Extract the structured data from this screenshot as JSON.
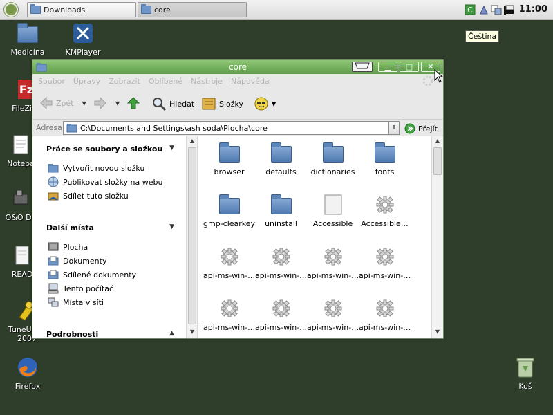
{
  "panel": {
    "tasks": [
      {
        "label": "Downloads"
      },
      {
        "label": "core"
      }
    ],
    "clock": "11:00",
    "language_tooltip": "Čeština"
  },
  "desktop": {
    "icons": [
      {
        "label": "Medicína"
      },
      {
        "label": "KMPlayer"
      },
      {
        "label": "FileZilla"
      },
      {
        "label": "Notepa"
      },
      {
        "label": "O&O De"
      },
      {
        "label": "READ"
      },
      {
        "label": "TuneUp U"
      },
      {
        "label": "2007"
      },
      {
        "label": "Firefox"
      },
      {
        "label": "Koš"
      }
    ]
  },
  "window": {
    "title": "core",
    "menu": [
      "Soubor",
      "Úpravy",
      "Zobrazit",
      "Oblíbené",
      "Nástroje",
      "Nápověda"
    ],
    "toolbar": {
      "back": "Zpět",
      "search": "Hledat",
      "folders": "Složky"
    },
    "address": {
      "label": "Adresa",
      "value": "C:\\Documents and Settings\\ash soda\\Plocha\\core",
      "go": "Přejít"
    },
    "tasks_section": {
      "title": "Práce se soubory a složkou",
      "items": [
        "Vytvořit novou složku",
        "Publikovat složky na webu",
        "Sdílet tuto složku"
      ]
    },
    "places_section": {
      "title": "Další místa",
      "items": [
        "Plocha",
        "Dokumenty",
        "Sdílené dokumenty",
        "Tento počítač",
        "Místa v síti"
      ]
    },
    "details_section": {
      "title": "Podrobnosti"
    },
    "files": [
      {
        "name": "browser",
        "type": "folder"
      },
      {
        "name": "defaults",
        "type": "folder"
      },
      {
        "name": "dictionaries",
        "type": "folder"
      },
      {
        "name": "fonts",
        "type": "folder"
      },
      {
        "name": "gmp-clearkey",
        "type": "folder"
      },
      {
        "name": "uninstall",
        "type": "folder"
      },
      {
        "name": "Accessible",
        "type": "file"
      },
      {
        "name": "Accessible…",
        "type": "gear"
      },
      {
        "name": "api-ms-win-…",
        "type": "gear"
      },
      {
        "name": "api-ms-win-…",
        "type": "gear"
      },
      {
        "name": "api-ms-win-…",
        "type": "gear"
      },
      {
        "name": "api-ms-win-…",
        "type": "gear"
      },
      {
        "name": "api-ms-win-…",
        "type": "gear"
      },
      {
        "name": "api-ms-win-…",
        "type": "gear"
      },
      {
        "name": "api-ms-win-…",
        "type": "gear"
      },
      {
        "name": "api-ms-win-…",
        "type": "gear"
      }
    ]
  },
  "colors": {
    "desktop": "#2f3d2b",
    "titlebar": "#6aa854",
    "folder": "#5f8ac0"
  }
}
